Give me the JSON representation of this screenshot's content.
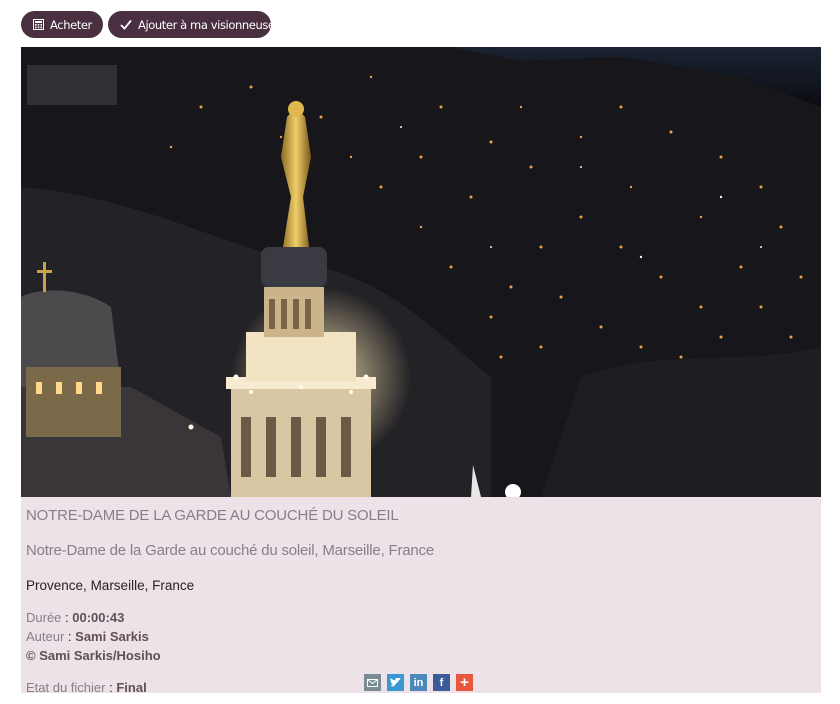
{
  "toolbar": {
    "buy_label": "Acheter",
    "add_label": "Ajouter à ma visionneuse"
  },
  "media": {
    "title": "NOTRE-DAME DE LA GARDE AU COUCHÉ DU SOLEIL",
    "description": "Notre-Dame de la Garde au couché du soleil, Marseille, France",
    "tags": [
      "Provence",
      "Marseille",
      "France"
    ],
    "tag_separator": ", "
  },
  "meta": {
    "duration_label": "Durée",
    "duration_value": "00:00:43",
    "author_label": "Auteur",
    "author_value": "Sami Sarkis",
    "copyright": "© Sami Sarkis/Hosiho",
    "file_state_label": "Etat du fichier",
    "file_state_value": "Final",
    "colon": " : "
  },
  "share": {
    "icons": [
      "email-icon",
      "twitter-icon",
      "linkedin-icon",
      "facebook-icon",
      "plus-icon"
    ]
  },
  "colors": {
    "button_bg": "#4a2f40",
    "panel_bg": "#ece2e7",
    "muted_text": "#8a7d88"
  }
}
